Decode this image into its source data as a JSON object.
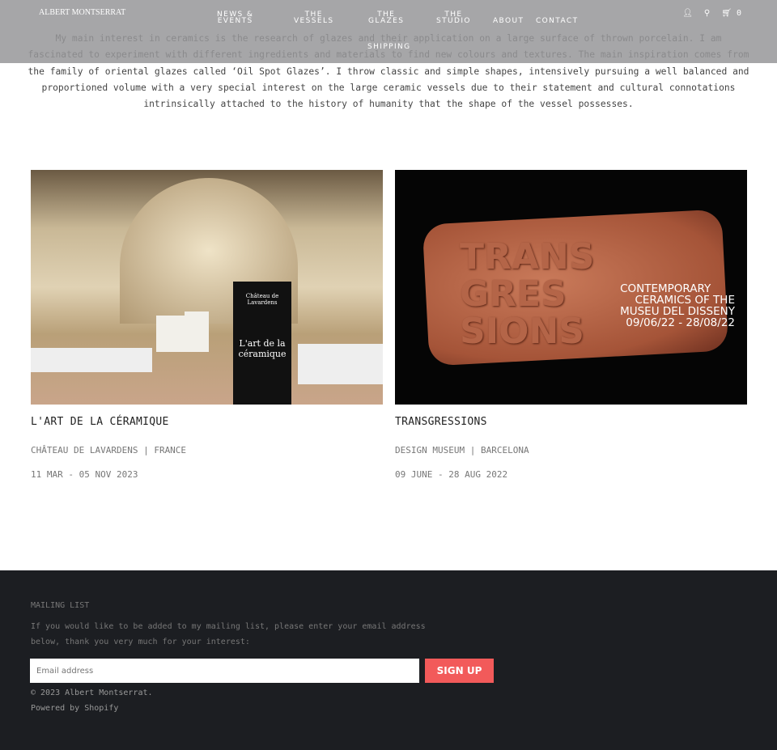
{
  "header": {
    "logo": "ALBERT MONTSERRAT",
    "nav": [
      "NEWS &\nEVENTS",
      "THE\nVESSELS",
      "THE\nGLAZES",
      "THE\nSTUDIO",
      "ABOUT",
      "CONTACT",
      "SHIPPING"
    ],
    "cart_count": "0"
  },
  "intro": "My main interest in ceramics is the research of glazes and their application on a large surface of thrown porcelain. I am fascinated to experiment with different ingredients and materials to find new colours and textures. The main inspiration comes from the family of oriental glazes called ‘Oil Spot Glazes’. I throw classic and simple shapes, intensively pursuing a well balanced and proportioned volume with a very special interest on the large ceramic vessels due to their statement and cultural connotations intrinsically attached to the history of humanity that the shape of the vessel possesses.",
  "events": [
    {
      "title": "L'ART DE LA CÉRAMIQUE",
      "location": "CHÂTEAU DE LAVARDENS | FRANCE",
      "dates": "11 MAR - 05 NOV 2023",
      "poster": {
        "venue": "Château de Lavardens",
        "name": "L'art de la céramique"
      }
    },
    {
      "title": "TRANSGRESSIONS",
      "location": "DESIGN MUSEUM | BARCELONA",
      "dates": "09 JUNE - 28 AUG 2022",
      "poster": {
        "clay": [
          "TRANS",
          "GRES",
          "SIONS"
        ],
        "lines": [
          "CONTEMPORARY",
          "CERAMICS OF THE",
          "MUSEU DEL DISSENY",
          "09/06/22 - 28/08/22"
        ]
      }
    }
  ],
  "footer": {
    "heading": "MAILING LIST",
    "text1": "If you would like to be added to my mailing list, please enter your email address",
    "text2": "below, thank you very much for your interest:",
    "placeholder": "Email address",
    "signup": "SIGN UP",
    "copyright": "© 2023 Albert Montserrat.",
    "powered": "Powered by Shopify"
  }
}
